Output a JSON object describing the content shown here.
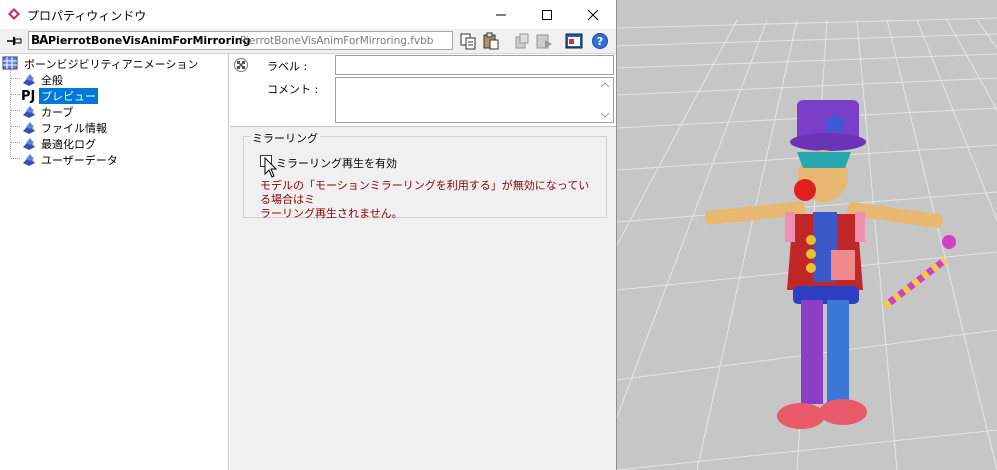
{
  "window": {
    "title": "プロパティウィンドウ",
    "controls": {
      "minimize": "minimize-icon",
      "maximize": "maximize-icon",
      "close": "close-icon"
    }
  },
  "toolbar": {
    "doc_icon": "BA",
    "doc_name": "PierrotBoneVisAnimForMirroring",
    "doc_file": "PierrotBoneVisAnimForMirroring.fvbb",
    "icons": [
      "pin-icon",
      "copy-icon",
      "paste-icon",
      "cut-icon",
      "paste-special-icon",
      "export-icon",
      "help-icon"
    ]
  },
  "tree": {
    "root": "ボーンビジビリティアニメーション",
    "items": [
      {
        "label": "全般",
        "icon": "component-icon"
      },
      {
        "label": "プレビュー",
        "icon": "pj-icon",
        "selected": true
      },
      {
        "label": "カーブ",
        "icon": "component-icon"
      },
      {
        "label": "ファイル情報",
        "icon": "component-icon"
      },
      {
        "label": "最適化ログ",
        "icon": "component-icon"
      },
      {
        "label": "ユーザーデータ",
        "icon": "component-icon"
      }
    ]
  },
  "props": {
    "label_caption": "ラベル :",
    "label_value": "",
    "comment_caption": "コメント :",
    "comment_value": ""
  },
  "mirroring": {
    "group_title": "ミラーリング",
    "checkbox_label": "ミラーリング再生を有効",
    "checked": false,
    "note_line1": "モデルの「モーションミラーリングを利用する」が無効になっている場合はミ",
    "note_line2": "ラーリング再生されません。"
  },
  "colors": {
    "selection": "#0078d7",
    "note_text": "#8b0000",
    "viewport_bg": "#c6c6c6"
  }
}
